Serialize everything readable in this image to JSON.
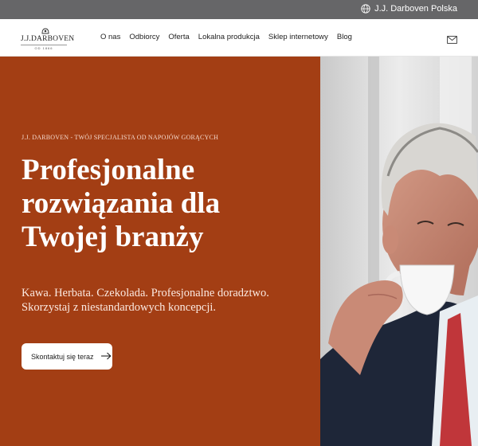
{
  "topbar": {
    "region_label": "J.J. Darboven Polska",
    "region_icon": "globe-icon"
  },
  "brand": {
    "name": "J.J.DARBOVEN",
    "since": "OD 1866"
  },
  "nav": {
    "items": [
      {
        "label": "O nas"
      },
      {
        "label": "Odbiorcy"
      },
      {
        "label": "Oferta"
      },
      {
        "label": "Lokalna produkcja"
      },
      {
        "label": "Sklep internetowy"
      },
      {
        "label": "Blog"
      }
    ],
    "mail_icon": "mail-icon"
  },
  "hero": {
    "eyebrow": "J.J. DARBOVEN - TWÓJ SPECJALISTA OD  NAPOJÓW GORĄCYCH",
    "headline": [
      "Profesjonalne",
      "rozwiązania dla",
      "Twojej branży"
    ],
    "subtext": [
      "Kawa. Herbata. Czekolada. Profesjonalne doradztwo.",
      "Skorzystaj z niestandardowych koncepcji."
    ],
    "cta_label": "Skontaktuj się teraz",
    "cta_icon": "arrow-right-icon",
    "photo": "man-drinking-coffee-photo"
  },
  "colors": {
    "accent": "#a33e14",
    "topbar": "#666668",
    "white": "#ffffff"
  }
}
